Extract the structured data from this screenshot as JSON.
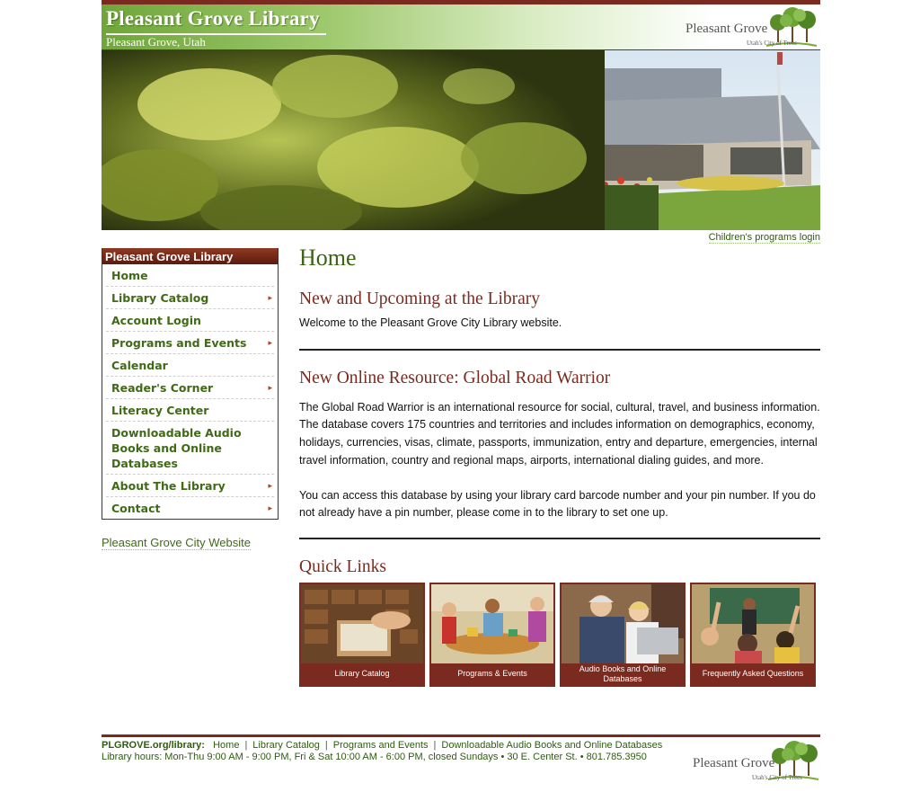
{
  "header": {
    "title": "Pleasant Grove Library",
    "subtitle": "Pleasant Grove, Utah",
    "logo_text": "Pleasant Grove",
    "logo_tagline": "Utah's City of Trees",
    "logo_icon": "trees-logo-icon"
  },
  "banner": {
    "icon": "library-building-photo"
  },
  "kids_login": "Children's programs login",
  "sidebar": {
    "heading": "Pleasant Grove Library",
    "items": [
      {
        "label": "Home",
        "has_submenu": false
      },
      {
        "label": "Library Catalog",
        "has_submenu": true
      },
      {
        "label": "Account Login",
        "has_submenu": false
      },
      {
        "label": "Programs and Events",
        "has_submenu": true
      },
      {
        "label": "Calendar",
        "has_submenu": false
      },
      {
        "label": "Reader's Corner",
        "has_submenu": true
      },
      {
        "label": "Literacy Center",
        "has_submenu": false
      },
      {
        "label": "Downloadable Audio Books and Online Databases",
        "has_submenu": false
      },
      {
        "label": "About The Library",
        "has_submenu": true
      },
      {
        "label": "Contact",
        "has_submenu": true
      }
    ],
    "arrow_glyph": "▸",
    "city_link": "Pleasant Grove City Website"
  },
  "main": {
    "page_title": "Home",
    "section1": {
      "heading": "New and Upcoming at the Library",
      "text": "Welcome to the Pleasant Grove City Library website."
    },
    "section2": {
      "heading": "New Online Resource: Global Road Warrior",
      "para1": "The Global Road Warrior is an international resource for social, cultural, travel, and business information. The database covers 175 countries and territories and includes information on demographics, economy, holidays, currencies, visas, climate, passports, immunization, entry and departure, emergencies, internal travel information, country and regional maps, airports, international dialing guides, and more.",
      "para2": "You can access this database by using your library card barcode number and your pin number. If you do not already have a pin number, please come in to the library to set one up."
    },
    "quick_links": {
      "heading": "Quick Links",
      "items": [
        {
          "label": "Library Catalog"
        },
        {
          "label": "Programs & Events"
        },
        {
          "label": "Audio Books and Online Databases"
        },
        {
          "label": "Frequently Asked Questions"
        }
      ]
    }
  },
  "footer": {
    "site_label": "PLGROVE.org/library:",
    "links": [
      "Home",
      "Library Catalog",
      "Programs and Events",
      "Downloadable Audio Books and Online Databases"
    ],
    "separator": "|",
    "hours": "Library hours: Mon-Thu 9:00 AM - 9:00 PM, Fri & Sat 10:00 AM - 6:00 PM, closed Sundays  •  30 E. Center St.  •  801.785.3950"
  },
  "colors": {
    "accent_maroon": "#7a2a1e",
    "link_green": "#3f6a16",
    "header_green": "#6fa53a"
  }
}
